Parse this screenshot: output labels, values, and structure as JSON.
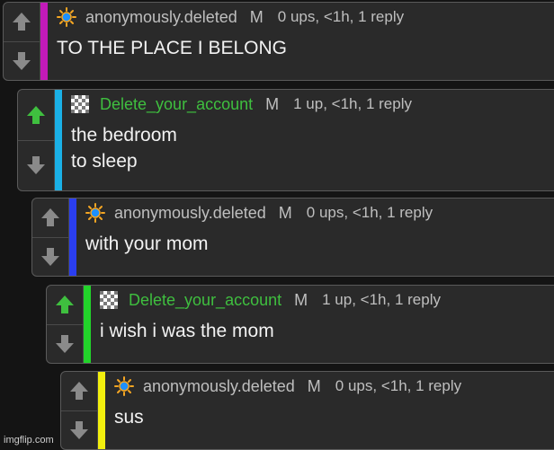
{
  "comments": [
    {
      "username": "anonymously.deleted",
      "flag": "M",
      "meta": "0 ups, <1h, 1 reply",
      "lines": [
        "TO THE PLACE I BELONG"
      ],
      "bar_color": "#c21ab8",
      "upvoted": false,
      "avatar": "sun-icon",
      "user_color": "#bfbfbf"
    },
    {
      "username": "Delete_your_account",
      "flag": "M",
      "meta": "1 up, <1h, 1 reply",
      "lines": [
        "the bedroom",
        "to sleep"
      ],
      "bar_color": "#1ab0e6",
      "upvoted": true,
      "avatar": "pixel-avatar-icon",
      "user_color": "#3fbf3f"
    },
    {
      "username": "anonymously.deleted",
      "flag": "M",
      "meta": "0 ups, <1h, 1 reply",
      "lines": [
        "with your mom"
      ],
      "bar_color": "#2a3ef0",
      "upvoted": false,
      "avatar": "sun-icon",
      "user_color": "#bfbfbf"
    },
    {
      "username": "Delete_your_account",
      "flag": "M",
      "meta": "1 up, <1h, 1 reply",
      "lines": [
        "i wish i was the mom"
      ],
      "bar_color": "#22d42a",
      "upvoted": true,
      "avatar": "pixel-avatar-icon",
      "user_color": "#3fbf3f"
    },
    {
      "username": "anonymously.deleted",
      "flag": "M",
      "meta": "0 ups, <1h, 1 reply",
      "lines": [
        "sus"
      ],
      "bar_color": "#f2ef0e",
      "upvoted": false,
      "avatar": "sun-icon",
      "user_color": "#bfbfbf"
    }
  ],
  "watermark": "imgflip.com"
}
